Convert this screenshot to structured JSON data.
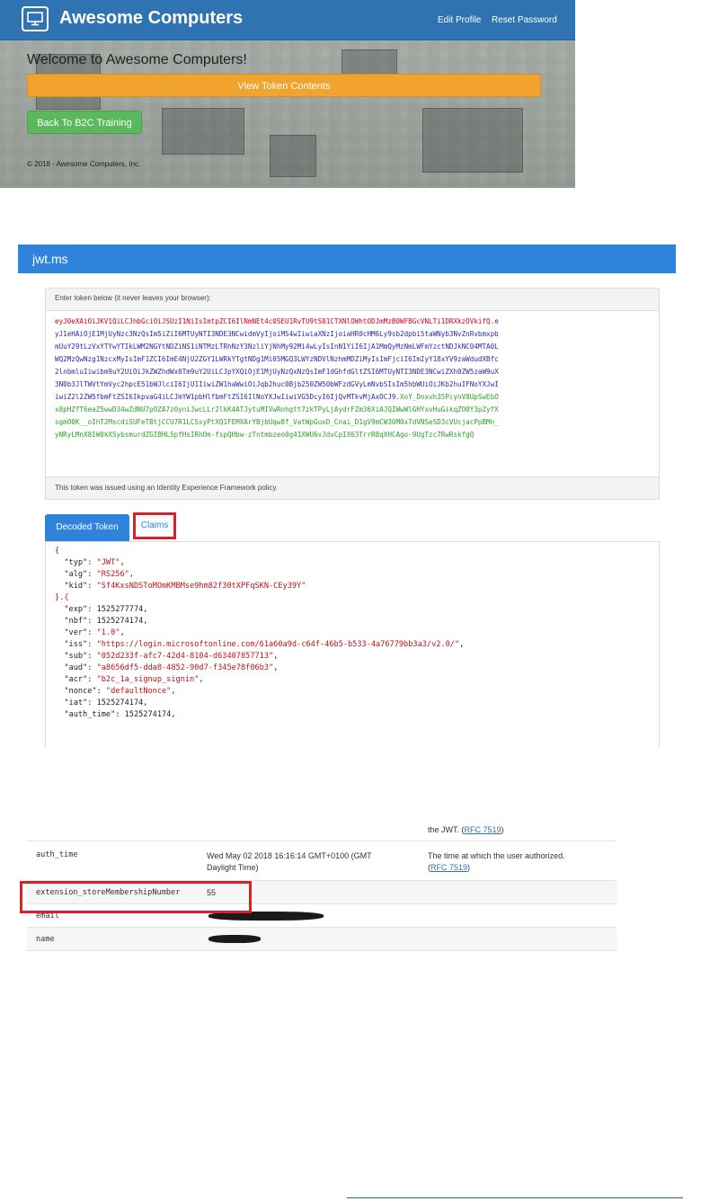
{
  "app": {
    "title": "Awesome Computers",
    "nav": {
      "edit_profile": "Edit Profile",
      "reset_password": "Reset Password"
    },
    "welcome": "Welcome to Awesome Computers!",
    "view_token_button": "View Token Contents",
    "back_button": "Back To B2C Training",
    "copyright": "© 2018 - Awesome Computers, Inc.",
    "colors": {
      "nav": "#2f73b3",
      "view_button": "#f0a32e",
      "back_button": "#5cb85c"
    }
  },
  "jwt": {
    "site_title": "jwt.ms",
    "token_prompt": "Enter token below (it never leaves your browser):",
    "token_lines": [
      {
        "hdr": "eyJ0eXAiOiJKV1QiLCJhbGciOiJSUzI1NiIsImtpZCI6IlNmNEt4c0SEU1RvTU9tS01CTXNlOWhtODJmMzB0WFBGcVNLTi1DRXkzOVkifQ.",
        "pay": "e"
      },
      {
        "pay": "yJ1eHAiOjE1MjUyNzc3NzQsIm5iZiI6MTUyNTI3NDE3NCwidmVyIjoiMS4wIiwiaXNzIjoiaHR0cHM6Ly9sb2dpbi5taWNyb3NvZnRvbmxpb"
      },
      {
        "pay": "mUuY29tLzVxYTYwYTIkLWM2NGYtNDZiNS1iNTMzLTRhNzY3NzliYjNhMy92Mi4wLyIsInN1YiI6IjA1MmQyMzNmLWFmYzctNDJkNC04MTA0L"
      },
      {
        "pay": "WQ2MzQwNzg1NzcxMyIsImF1ZCI6ImE4NjU2ZGY1LWRkYTgtNDg1Mi05MGQ3LWYzNDVlNzhmMDZiMyIsImFjciI6ImIyY18xYV9zaWdudXBfc"
      },
      {
        "pay": "2lnbmluIiwibm9uY2UiOiJkZWZhdWx0Tm9uY2UiLCJpYXQiOjE1MjUyNzQxNzQsImF1dGhfdGltZSI6MTUyNTI3NDE3NCwiZXh0ZW5zaW9uX"
      },
      {
        "pay": "3N0b3JlTWVtYmVyc2hpcE51bWJlciI6IjU1IiwiZW1haWwiOiJqb2huc0Bjb250ZW50bWFzdGVyLmNvbSIsIm5hbWUiOiJKb2huIFNoYXJwI"
      },
      {
        "pay": "iwiZ2l2ZW5fbmFtZSI6IkpvaG4iLCJmYW1pbHlfbmFtZSI6IlNoYXJwIiwiVG5DcyI6IjQvMTkvMjAxOCJ9.",
        "sig": "XoY_Doxvh35PcynV8UpSwEbO"
      },
      {
        "sig": "x8pHZfT6eaZ5wwD34wZdNU7pOZA7z0yniJwcLLr2lkK4ATJytuMIVwRnhgtt7zkTPyLjAydrFZm36XiAJQIWwWlGHYxvHuGikqZO0Y3pZyfX"
      },
      {
        "sig": "sgmO0K__oIhT2MscdiSUFeTBtjCCU7R1LCSsyPtXQ1FEMXArYBjbUqw8f_VatWpGuxD_Cnai_D1gV9mCW30M0x7dVNSeSD3cVUcjacPpBMn_"
      },
      {
        "sig": "yNRyLMnX81W0kXSybsmurdZGIBHL5pfHsIRhOm-fspQHbw-zTntmbzeo0g41XWU6vJdvCpIX63TrrR8qXHCAgo-9UgTzc7RwRskfgQ"
      }
    ],
    "token_footer": "This token was issued using an Identity Experience Framework policy.",
    "tabs": {
      "decoded": "Decoded Token",
      "claims": "Claims"
    },
    "decoded_lines": [
      "{",
      "  \"typ\": \"JWT\",",
      "  \"alg\": \"RS256\",",
      "  \"kid\": \"Sf4KxsNDSToMOmKMBMse9hm82f30tXPFqSKN-CEy39Y\"",
      "}.{",
      "  \"exp\": 1525277774,",
      "  \"nbf\": 1525274174,",
      "  \"ver\": \"1.0\",",
      "  \"iss\": \"https://login.microsoftonline.com/61a60a9d-c64f-46b5-b533-4a76779bb3a3/v2.0/\",",
      "  \"sub\": \"052d233f-afc7-42d4-8104-d63407857713\",",
      "  \"aud\": \"a8656df5-dda8-4852-90d7-f345e78f06b3\",",
      "  \"acr\": \"b2c_1a_signup_signin\",",
      "  \"nonce\": \"defaultNonce\",",
      "  \"iat\": 1525274174,",
      "  \"auth_time\": 1525274174,"
    ],
    "colors": {
      "header": "#2f83db",
      "token_header": "#d0021b",
      "token_payload": "#2b2ba8",
      "token_signature": "#2f9d27"
    }
  },
  "claims_table": {
    "partial_top": {
      "desc": "the JWT.",
      "link": "RFC 7519"
    },
    "rows": [
      {
        "claim": "auth_time",
        "value": "Wed May 02 2018 16:16:14 GMT+0100 (GMT Daylight Time)",
        "desc": "The time at which the user authorized.",
        "link": "RFC 7519"
      },
      {
        "claim": "extension_storeMembershipNumber",
        "value": "55",
        "desc": "",
        "link": ""
      },
      {
        "claim": "email",
        "value": "",
        "desc": "",
        "link": ""
      },
      {
        "claim": "name",
        "value": "",
        "desc": "",
        "link": ""
      }
    ]
  }
}
